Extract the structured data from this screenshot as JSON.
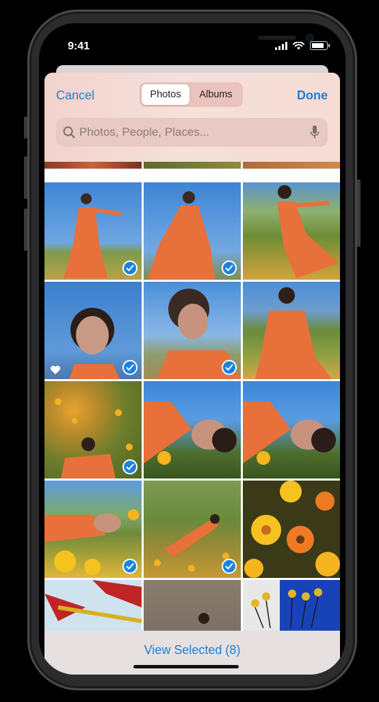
{
  "status_bar": {
    "time": "9:41"
  },
  "header": {
    "cancel_label": "Cancel",
    "done_label": "Done",
    "segments": [
      {
        "label": "Photos",
        "selected": true
      },
      {
        "label": "Albums",
        "selected": false
      }
    ]
  },
  "search": {
    "placeholder": "Photos, People, Places..."
  },
  "grid": {
    "columns": 3,
    "photos": [
      {
        "subject": "woman in orange dress, blue sky",
        "selected": true
      },
      {
        "subject": "woman in orange dress, blue sky",
        "selected": true
      },
      {
        "subject": "woman in orange dress in field",
        "selected": false
      },
      {
        "subject": "smiling woman portrait",
        "selected": true,
        "favorite": true
      },
      {
        "subject": "woman portrait closeup",
        "selected": true
      },
      {
        "subject": "woman sitting in grass",
        "selected": false
      },
      {
        "subject": "woman lying in flowers",
        "selected": true
      },
      {
        "subject": "woman lying with flower",
        "selected": false
      },
      {
        "subject": "woman lying with flower",
        "selected": false
      },
      {
        "subject": "woman lying among yellow flowers",
        "selected": true
      },
      {
        "subject": "woman lying in field",
        "selected": true
      },
      {
        "subject": "orange and yellow flowers",
        "selected": false
      },
      {
        "subject": "red leaves",
        "selected": false
      },
      {
        "subject": "concrete wall",
        "selected": false
      },
      {
        "subject": "yellow flowers against blue wall",
        "selected": false
      }
    ]
  },
  "footer": {
    "view_selected_label": "View Selected (8)"
  },
  "colors": {
    "accent": "#1a7fd4",
    "check": "#1a82e0",
    "sky": "#4a8fd8",
    "dress": "#e8703a"
  }
}
